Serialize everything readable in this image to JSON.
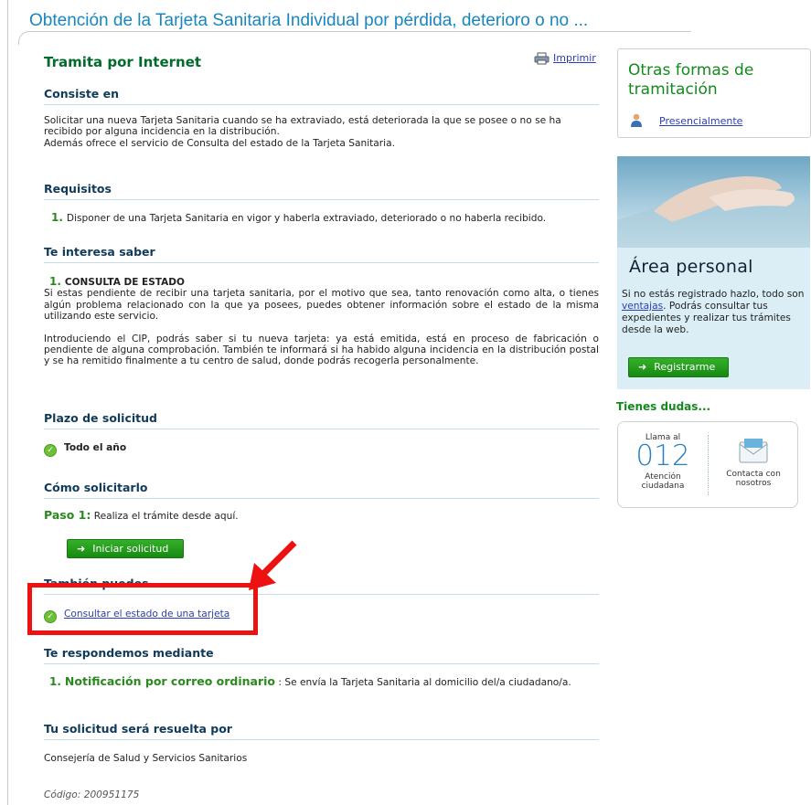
{
  "page": {
    "title": "Obtención de la Tarjeta Sanitaria Individual por pérdida, deterioro o no ..."
  },
  "main": {
    "heading": "Tramita por Internet",
    "print_label": "Imprimir",
    "consiste": {
      "heading": "Consiste en",
      "lines": [
        "Solicitar una nueva Tarjeta Sanitaria cuando se ha extraviado, está deteriorada la que se posee o no se ha recibido por alguna incidencia en la distribución.",
        "Además ofrece el servicio de Consulta del estado de la Tarjeta Sanitaria."
      ]
    },
    "requisitos": {
      "heading": "Requisitos",
      "num": "1.",
      "text": "Disponer de una Tarjeta Sanitaria en vigor y haberla extraviado, deteriorado o no haberla recibido."
    },
    "interesa": {
      "heading": "Te interesa saber",
      "num": "1.",
      "item_title": "CONSULTA DE ESTADO",
      "p1": "Si estas pendiente de recibir una tarjeta sanitaria, por el motivo que sea, tanto renovación como alta, o tienes algún problema relacionado con la que ya posees, puedes obtener información sobre el estado de la misma utilizando este servicio.",
      "p2": "Introduciendo el CIP, podrás saber si tu nueva tarjeta: ya está emitida, está en proceso de fabricación o pendiente de alguna comprobación. También te informará si ha habido alguna incidencia en la distribución postal y se ha remitido finalmente a tu centro de salud, donde podrás recogerla personalmente."
    },
    "plazo": {
      "heading": "Plazo de solicitud",
      "value": "Todo el año"
    },
    "como": {
      "heading": "Cómo solicitarlo",
      "step_label": "Paso 1:",
      "step_text": "Realiza el trámite desde aquí.",
      "button": "Iniciar solicitud"
    },
    "tambien": {
      "heading": "También puedes",
      "link": "Consultar el estado de una tarjeta"
    },
    "respondemos": {
      "heading": "Te respondemos mediante",
      "num": "1.",
      "title": "Notificación por correo ordinario",
      "text": ": Se envía la Tarjeta Sanitaria al domicilio del/a ciudadano/a."
    },
    "resuelta": {
      "heading": "Tu solicitud será resuelta por",
      "text": "Consejería de Salud y Servicios Sanitarios"
    },
    "codigo": {
      "label": "Código:",
      "value": "200951175"
    }
  },
  "sidebar": {
    "otras": {
      "title": "Otras formas de tramitación",
      "link": "Presencialmente"
    },
    "area": {
      "title": "Área personal",
      "text_before": "Si no estás registrado hazlo, todo son",
      "link": "ventajas",
      "text_after": ". Podrás consultar tus expedientes y realizar tus trámites desde la web.",
      "button": "Registrarme"
    },
    "dudas": {
      "title": "Tienes dudas...",
      "call_label": "Llama al",
      "number": "012",
      "call_caption": "Atención ciudadana",
      "contact_caption": "Contacta con nosotros"
    }
  },
  "colors": {
    "title_blue": "#1a86bf",
    "green": "#2b8a1e",
    "highlight_red": "#ee1111"
  }
}
